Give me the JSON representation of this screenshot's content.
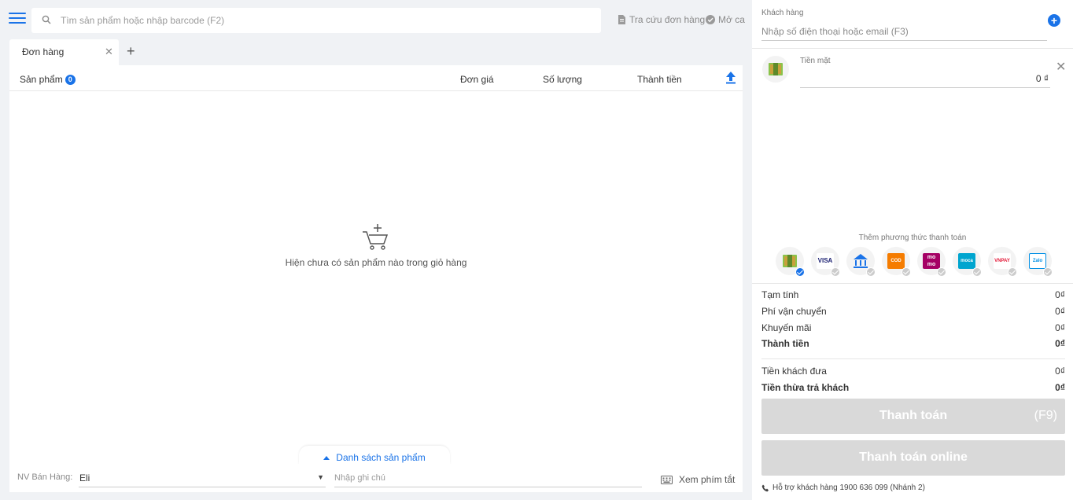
{
  "search": {
    "placeholder": "Tìm sản phẩm hoặc nhập barcode (F2)"
  },
  "top_links": {
    "order_lookup": "Tra cứu đơn hàng",
    "open_shift": "Mở ca"
  },
  "tabs": [
    {
      "label": "Đơn hàng"
    }
  ],
  "cart": {
    "columns": {
      "product": "Sản phẩm",
      "unit_price": "Đơn giá",
      "quantity": "Số lượng",
      "total": "Thành tiền"
    },
    "product_count": "0",
    "empty_message": "Hiện chưa có sản phẩm nào trong giỏ hàng"
  },
  "product_list_toggle": "Danh sách sản phẩm",
  "bottom_bar": {
    "staff_label": "NV Bán Hàng:",
    "staff_value": "Eli",
    "note_placeholder": "Nhập ghi chú",
    "shortcuts_label": "Xem phím tắt"
  },
  "customer": {
    "label": "Khách hàng",
    "placeholder": "Nhập số điện thoại hoặc email (F3)"
  },
  "payment": {
    "method_label": "Tiền mặt",
    "amount": "0 ₫",
    "add_method_label": "Thêm phương thức thanh toán",
    "methods": [
      {
        "icon": "cash-icon",
        "text": "",
        "selected": true
      },
      {
        "icon": "visa-mastercard-icon",
        "text": "VISA",
        "selected": false
      },
      {
        "icon": "bank-transfer-icon",
        "text": "",
        "selected": false
      },
      {
        "icon": "cod-icon",
        "text": "COD",
        "selected": false
      },
      {
        "icon": "momo-icon",
        "text": "mo mo",
        "selected": false
      },
      {
        "icon": "moca-grab-icon",
        "text": "moca",
        "selected": false
      },
      {
        "icon": "vnpay-icon",
        "text": "VNPAY",
        "selected": false
      },
      {
        "icon": "zalopay-icon",
        "text": "Zalo",
        "selected": false
      }
    ]
  },
  "summary": {
    "subtotal_label": "Tạm tính",
    "subtotal": "0₫",
    "shipping_label": "Phí vận chuyển",
    "shipping": "0₫",
    "discount_label": "Khuyến mãi",
    "discount": "0₫",
    "total_label": "Thành tiền",
    "total": "0₫",
    "paid_label": "Tiền khách đưa",
    "paid": "0₫",
    "change_label": "Tiền thừa trả khách",
    "change": "0₫"
  },
  "buttons": {
    "pay": "Thanh toán",
    "pay_key": "(F9)",
    "pay_online": "Thanh toán online"
  },
  "support": "Hỗ trợ khách hàng 1900 636 099 (Nhánh 2)",
  "colors": {
    "accent": "#1a73e8",
    "disabled_button": "#d9d9d9",
    "background": "#f0f2f5"
  }
}
